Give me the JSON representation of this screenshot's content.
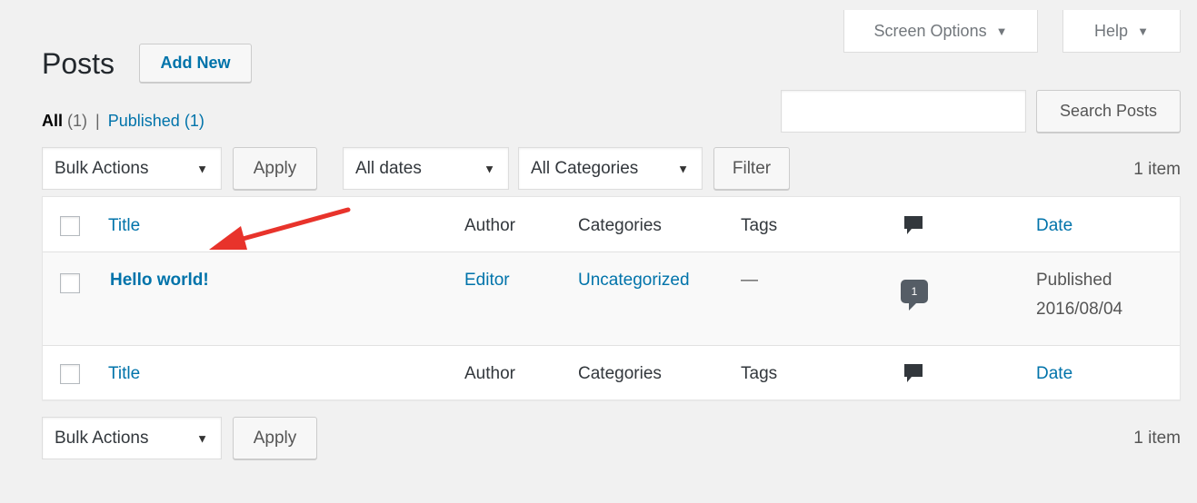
{
  "screen_tabs": {
    "screen_options": "Screen Options",
    "help": "Help",
    "caret": "▼"
  },
  "header": {
    "title": "Posts",
    "add_new": "Add New"
  },
  "subsubsub": {
    "all_label": "All",
    "all_count": "(1)",
    "separator": "|",
    "published_label": "Published",
    "published_count": "(1)"
  },
  "search": {
    "value": "",
    "button": "Search Posts"
  },
  "top_nav": {
    "bulk_actions": "Bulk Actions",
    "apply": "Apply",
    "dates": "All dates",
    "categories": "All Categories",
    "filter": "Filter",
    "count": "1 item",
    "caret": "▼"
  },
  "table": {
    "columns": {
      "title": "Title",
      "author": "Author",
      "categories": "Categories",
      "tags": "Tags",
      "date": "Date"
    },
    "rows": [
      {
        "title": "Hello world!",
        "author": "Editor",
        "categories": "Uncategorized",
        "tags": "—",
        "comments": "1",
        "status": "Published",
        "date": "2016/08/04"
      }
    ]
  },
  "bottom_nav": {
    "bulk_actions": "Bulk Actions",
    "apply": "Apply",
    "count": "1 item",
    "caret": "▼"
  },
  "colors": {
    "background": "#f1f1f1",
    "link": "#0073aa",
    "annotation_arrow": "#e8332b",
    "comment_bubble": "#555d66"
  }
}
